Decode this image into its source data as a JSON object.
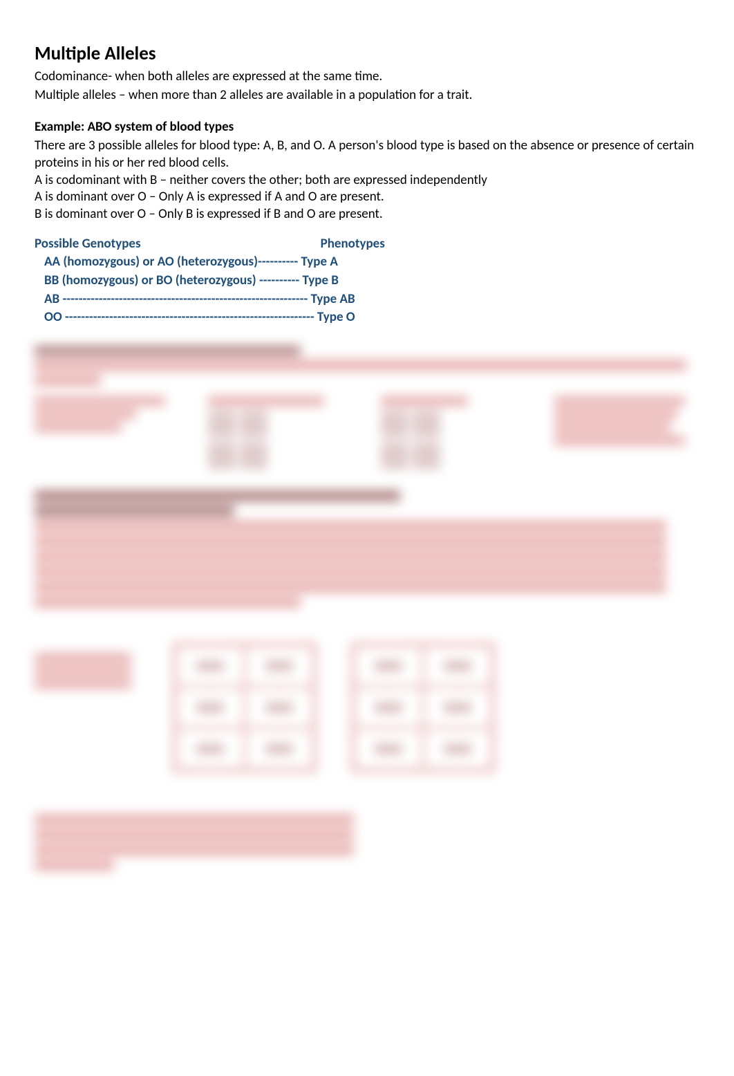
{
  "title": "Multiple Alleles",
  "intro": {
    "line1": "Codominance- when both alleles are expressed at the same time.",
    "line2": "Multiple alleles – when more than 2 alleles are available in a population for a trait."
  },
  "example": {
    "header": "Example: ABO system of blood types",
    "p1": "There are 3 possible alleles for blood type: A, B, and O. A person's blood type is based on the absence or presence of certain proteins in his or her red blood cells.",
    "p2": "A is codominant with B – neither covers the other; both are expressed independently",
    "p3": "A is dominant over O – Only A is expressed if A and O are present.",
    "p4": "B is dominant over O – Only B is expressed if B and O are present."
  },
  "genotypes": {
    "header_left": "Possible Genotypes",
    "header_right": "Phenotypes",
    "row1": "AA (homozygous) or   AO (heterozygous)---------- Type A",
    "row2": "BB (homozygous) or BO (heterozygous) ---------- Type B",
    "row3": "AB ------------------------------------------------------------- Type AB",
    "row4": "OO -------------------------------------------------------------- Type O"
  }
}
